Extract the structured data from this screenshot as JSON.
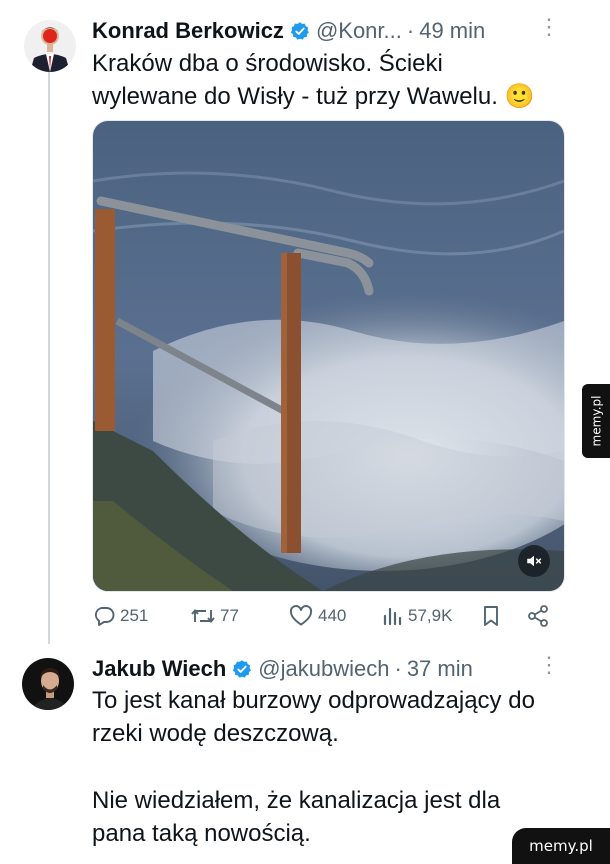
{
  "tweet1": {
    "author_name": "Konrad Berkowicz",
    "handle": "@Konr...",
    "separator": "·",
    "time": "49 min",
    "text_line1": "Kraków dba o środowisko. Ścieki",
    "text_line2": "wylewane do Wisły - tuż przy Wawelu. 🙂",
    "media": {
      "type": "video",
      "mute_icon": "speaker-muted-icon"
    },
    "actions": {
      "replies": "251",
      "reposts": "77",
      "likes": "440",
      "views": "57,9K"
    }
  },
  "tweet2": {
    "author_name": "Jakub Wiech",
    "handle": "@jakubwiech",
    "separator": "·",
    "time": "37 min",
    "text_line1": "To jest kanał burzowy odprowadzający do",
    "text_line2": "rzeki wodę deszczową.",
    "text_line3": "Nie wiedziałem, że kanalizacja jest dla",
    "text_line4": "pana taką nowością."
  },
  "watermark": {
    "side": "memy.pl",
    "corner": "memy.pl"
  },
  "colors": {
    "verified": "#1d9bf0",
    "secondary_text": "#536471",
    "thread_line": "#cfd9de"
  }
}
